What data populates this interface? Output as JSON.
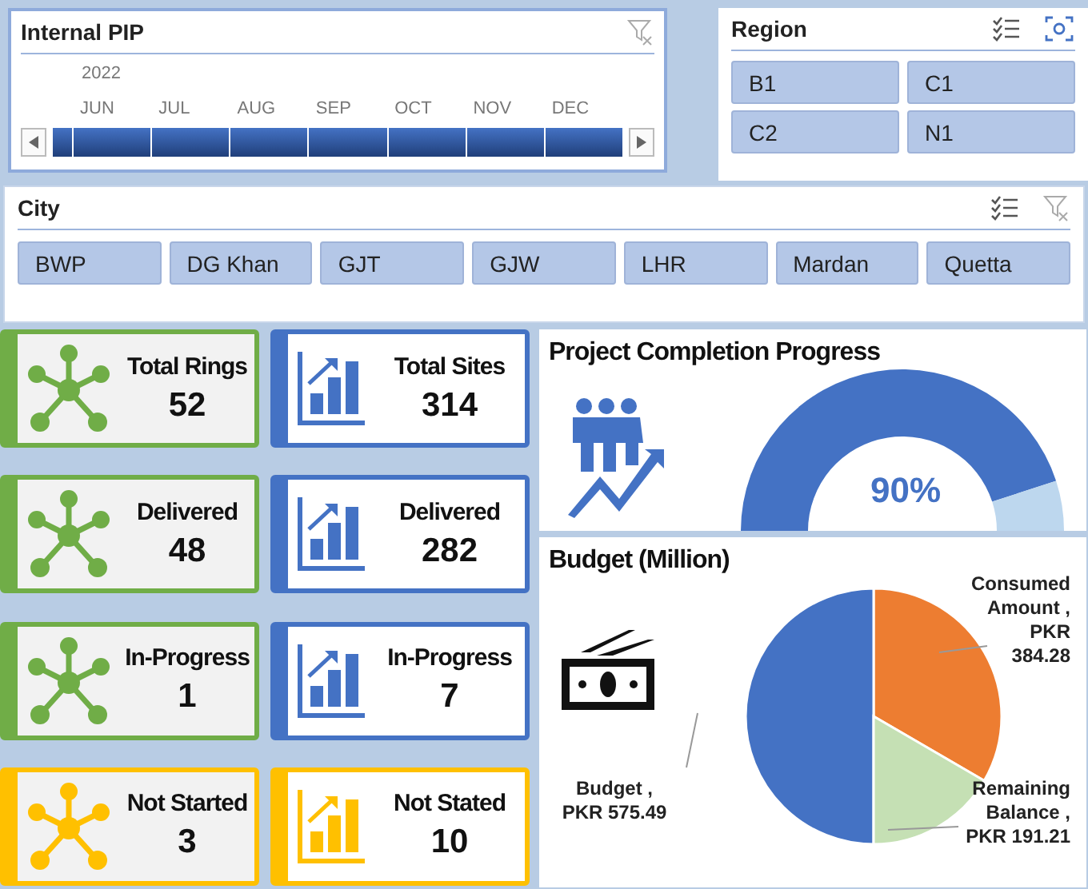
{
  "timeline": {
    "title": "Internal PIP",
    "year": "2022",
    "months": [
      {
        "label": "JUN",
        "selected": true
      },
      {
        "label": "JUL",
        "selected": true
      },
      {
        "label": "AUG",
        "selected": true
      },
      {
        "label": "SEP",
        "selected": true
      },
      {
        "label": "OCT",
        "selected": true
      },
      {
        "label": "NOV",
        "selected": true
      },
      {
        "label": "DEC",
        "selected": true
      }
    ]
  },
  "region": {
    "title": "Region",
    "items": [
      {
        "label": "B1",
        "selected": true
      },
      {
        "label": "C1",
        "selected": true
      },
      {
        "label": "C2",
        "selected": true
      },
      {
        "label": "N1",
        "selected": true
      }
    ]
  },
  "city": {
    "title": "City",
    "items": [
      {
        "label": "BWP",
        "selected": true
      },
      {
        "label": "DG Khan",
        "selected": true
      },
      {
        "label": "GJT",
        "selected": true
      },
      {
        "label": "GJW",
        "selected": true
      },
      {
        "label": "LHR",
        "selected": true
      },
      {
        "label": "Mardan",
        "selected": true
      },
      {
        "label": "Quetta",
        "selected": true
      }
    ]
  },
  "cards": [
    {
      "kind": "rings",
      "label": "Total Rings",
      "value": "52",
      "color": "#70ad47"
    },
    {
      "kind": "sites",
      "label": "Total Sites",
      "value": "314",
      "color": "#4472c4"
    },
    {
      "kind": "rings",
      "label": "Delivered",
      "value": "48",
      "color": "#70ad47"
    },
    {
      "kind": "sites",
      "label": "Delivered",
      "value": "282",
      "color": "#4472c4"
    },
    {
      "kind": "rings",
      "label": "In-Progress",
      "value": "1",
      "color": "#70ad47"
    },
    {
      "kind": "sites",
      "label": "In-Progress",
      "value": "7",
      "color": "#4472c4"
    },
    {
      "kind": "rings",
      "label": "Not Started",
      "value": "3",
      "color": "#ffc000"
    },
    {
      "kind": "sites",
      "label": "Not Stated",
      "value": "10",
      "color": "#ffc000"
    }
  ],
  "progress": {
    "title": "Project Completion Progress",
    "reading": "90%"
  },
  "budget": {
    "title": "Budget (Million)",
    "chart_data": {
      "type": "pie",
      "categories": [
        "Consumed Amount , PKR 384.28",
        "Budget , PKR 575.49",
        "Remaining Balance , PKR 191.21"
      ],
      "values": [
        384.28,
        575.49,
        191.21
      ],
      "colors": [
        "#ed7d31",
        "#4472c4",
        "#c5e0b4"
      ]
    }
  }
}
